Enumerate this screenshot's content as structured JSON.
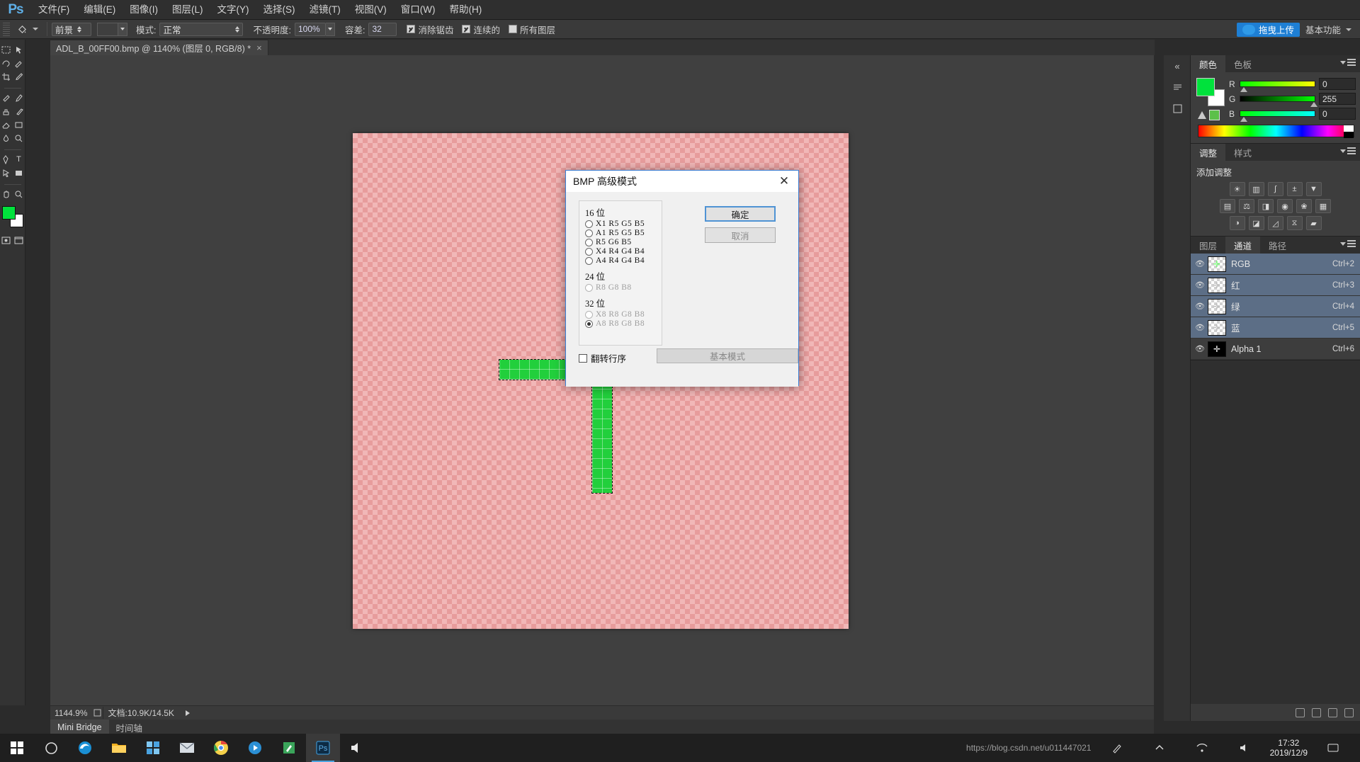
{
  "app": {
    "name": "Photoshop",
    "logo": "Ps"
  },
  "menubar": {
    "items": [
      {
        "label": "文件(F)"
      },
      {
        "label": "编辑(E)"
      },
      {
        "label": "图像(I)"
      },
      {
        "label": "图层(L)"
      },
      {
        "label": "文字(Y)"
      },
      {
        "label": "选择(S)"
      },
      {
        "label": "滤镜(T)"
      },
      {
        "label": "视图(V)"
      },
      {
        "label": "窗口(W)"
      },
      {
        "label": "帮助(H)"
      }
    ]
  },
  "options_bar": {
    "fill_source": "前景",
    "mode_label": "模式:",
    "mode_value": "正常",
    "opacity_label": "不透明度:",
    "opacity_value": "100%",
    "tolerance_label": "容差:",
    "tolerance_value": "32",
    "antialias_label": "消除锯齿",
    "contiguous_label": "连续的",
    "all_layers_label": "所有图层",
    "upload_label": "拖曳上传",
    "workspace_label": "基本功能"
  },
  "document": {
    "tab_title": "ADL_B_00FF00.bmp @ 1140% (图层 0, RGB/8) *",
    "close_glyph": "×"
  },
  "statusbar": {
    "zoom": "1144.9%",
    "doc_info": "文档:10.9K/14.5K"
  },
  "bottom_tabs": [
    {
      "label": "Mini Bridge",
      "active": true
    },
    {
      "label": "时间轴",
      "active": false
    }
  ],
  "color_panel": {
    "tabs": [
      {
        "label": "颜色",
        "active": true
      },
      {
        "label": "色板",
        "active": false
      }
    ],
    "channels": [
      {
        "label": "R",
        "value": "0"
      },
      {
        "label": "G",
        "value": "255"
      },
      {
        "label": "B",
        "value": "0"
      }
    ],
    "foreground_hex": "#00FF00",
    "background_hex": "#FFFFFF"
  },
  "adjustments_panel": {
    "tabs": [
      {
        "label": "调整",
        "active": true
      },
      {
        "label": "样式",
        "active": false
      }
    ],
    "title": "添加调整",
    "rows": [
      [
        "brightness-icon",
        "levels-icon",
        "curves-icon",
        "exposure-icon",
        "vibrance-icon"
      ],
      [
        "hue-saturation-icon",
        "color-balance-icon",
        "black-white-icon",
        "photo-filter-icon",
        "channel-mixer-icon",
        "color-lookup-icon"
      ],
      [
        "invert-icon",
        "posterize-icon",
        "threshold-icon",
        "selective-color-icon",
        "gradient-map-icon"
      ]
    ]
  },
  "channels_panel": {
    "tabs": [
      {
        "label": "图层",
        "active": false
      },
      {
        "label": "通道",
        "active": true
      },
      {
        "label": "路径",
        "active": false
      }
    ],
    "rows": [
      {
        "name": "RGB",
        "shortcut": "Ctrl+2",
        "selected": true,
        "alpha": false
      },
      {
        "name": "红",
        "shortcut": "Ctrl+3",
        "selected": true,
        "alpha": false
      },
      {
        "name": "绿",
        "shortcut": "Ctrl+4",
        "selected": true,
        "alpha": false
      },
      {
        "name": "蓝",
        "shortcut": "Ctrl+5",
        "selected": true,
        "alpha": false
      },
      {
        "name": "Alpha 1",
        "shortcut": "Ctrl+6",
        "selected": false,
        "alpha": true
      }
    ]
  },
  "dialog": {
    "title": "BMP 高级模式",
    "close_glyph": "✕",
    "groups": [
      {
        "heading": "16 位",
        "options": [
          {
            "label": "X1 R5 G5 B5",
            "selected": false,
            "disabled": false
          },
          {
            "label": "A1 R5 G5 B5",
            "selected": false,
            "disabled": false
          },
          {
            "label": "R5 G6 B5",
            "selected": false,
            "disabled": false
          },
          {
            "label": "X4 R4 G4 B4",
            "selected": false,
            "disabled": false
          },
          {
            "label": "A4 R4 G4 B4",
            "selected": false,
            "disabled": false
          }
        ]
      },
      {
        "heading": "24 位",
        "options": [
          {
            "label": "R8 G8 B8",
            "selected": false,
            "disabled": true
          }
        ]
      },
      {
        "heading": "32 位",
        "options": [
          {
            "label": "X8 R8 G8 B8",
            "selected": false,
            "disabled": true
          },
          {
            "label": "A8 R8 G8 B8",
            "selected": true,
            "disabled": false
          }
        ]
      }
    ],
    "flip_row_order_label": "翻转行序",
    "flip_row_order_checked": false,
    "ok_label": "确定",
    "cancel_label": "取消",
    "basic_mode_label": "基本模式"
  },
  "taskbar": {
    "clock_time": "17:32",
    "clock_date": "2019/12/9",
    "watermark": "https://blog.csdn.net/u011447021"
  }
}
